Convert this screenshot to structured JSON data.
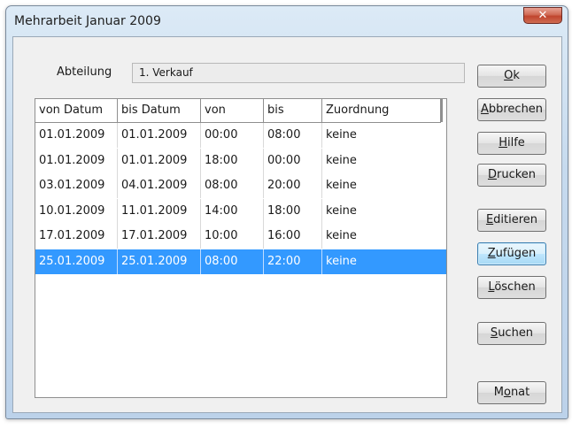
{
  "window": {
    "title": "Mehrarbeit Januar 2009",
    "close_glyph": "✕"
  },
  "abteilung": {
    "label": "Abteilung",
    "value": "1. Verkauf"
  },
  "table": {
    "columns": [
      "von Datum",
      "bis Datum",
      "von",
      "bis",
      "Zuordnung"
    ],
    "rows": [
      [
        "01.01.2009",
        "01.01.2009",
        "00:00",
        "08:00",
        "keine"
      ],
      [
        "01.01.2009",
        "01.01.2009",
        "18:00",
        "00:00",
        "keine"
      ],
      [
        "03.01.2009",
        "04.01.2009",
        "08:00",
        "20:00",
        "keine"
      ],
      [
        "10.01.2009",
        "11.01.2009",
        "14:00",
        "18:00",
        "keine"
      ],
      [
        "17.01.2009",
        "17.01.2009",
        "10:00",
        "16:00",
        "keine"
      ],
      [
        "25.01.2009",
        "25.01.2009",
        "08:00",
        "22:00",
        "keine"
      ]
    ],
    "selected_row": 5
  },
  "buttons": [
    {
      "name": "ok-button",
      "pre": "",
      "key": "O",
      "post": "k"
    },
    {
      "name": "abbrechen-button",
      "pre": "",
      "key": "A",
      "post": "bbrechen"
    },
    {
      "name": "hilfe-button",
      "pre": "",
      "key": "H",
      "post": "ilfe"
    },
    {
      "name": "drucken-button",
      "pre": "",
      "key": "D",
      "post": "rucken"
    },
    {
      "name": "editieren-button",
      "pre": "",
      "key": "E",
      "post": "ditieren"
    },
    {
      "name": "zufuegen-button",
      "pre": "",
      "key": "Z",
      "post": "ufügen"
    },
    {
      "name": "loeschen-button",
      "pre": "",
      "key": "L",
      "post": "öschen"
    },
    {
      "name": "suchen-button",
      "pre": "",
      "key": "S",
      "post": "uchen"
    },
    {
      "name": "monat-button",
      "pre": "M",
      "key": "o",
      "post": "nat"
    }
  ],
  "colors": {
    "selection": "#3399ff",
    "dialog_bg": "#f0f0f0"
  }
}
